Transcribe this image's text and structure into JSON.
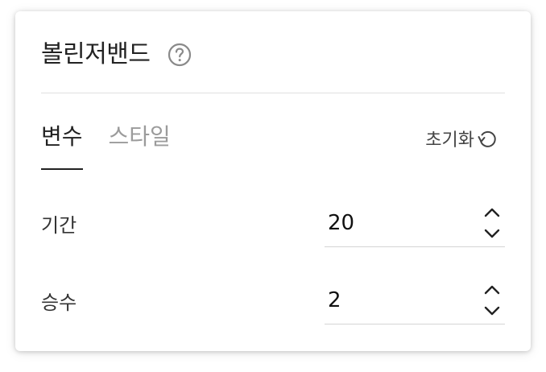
{
  "panel": {
    "title": "볼린저밴드",
    "help_icon": "question-circle-icon"
  },
  "tabs": [
    {
      "label": "변수",
      "active": true
    },
    {
      "label": "스타일",
      "active": false
    }
  ],
  "reset": {
    "label": "초기화",
    "icon": "reset-arrow-icon"
  },
  "fields": [
    {
      "label": "기간",
      "value": "20"
    },
    {
      "label": "승수",
      "value": "2"
    }
  ],
  "colors": {
    "text": "#222222",
    "inactive_tab": "#9b9b9b",
    "divider": "#e0e0e0"
  }
}
